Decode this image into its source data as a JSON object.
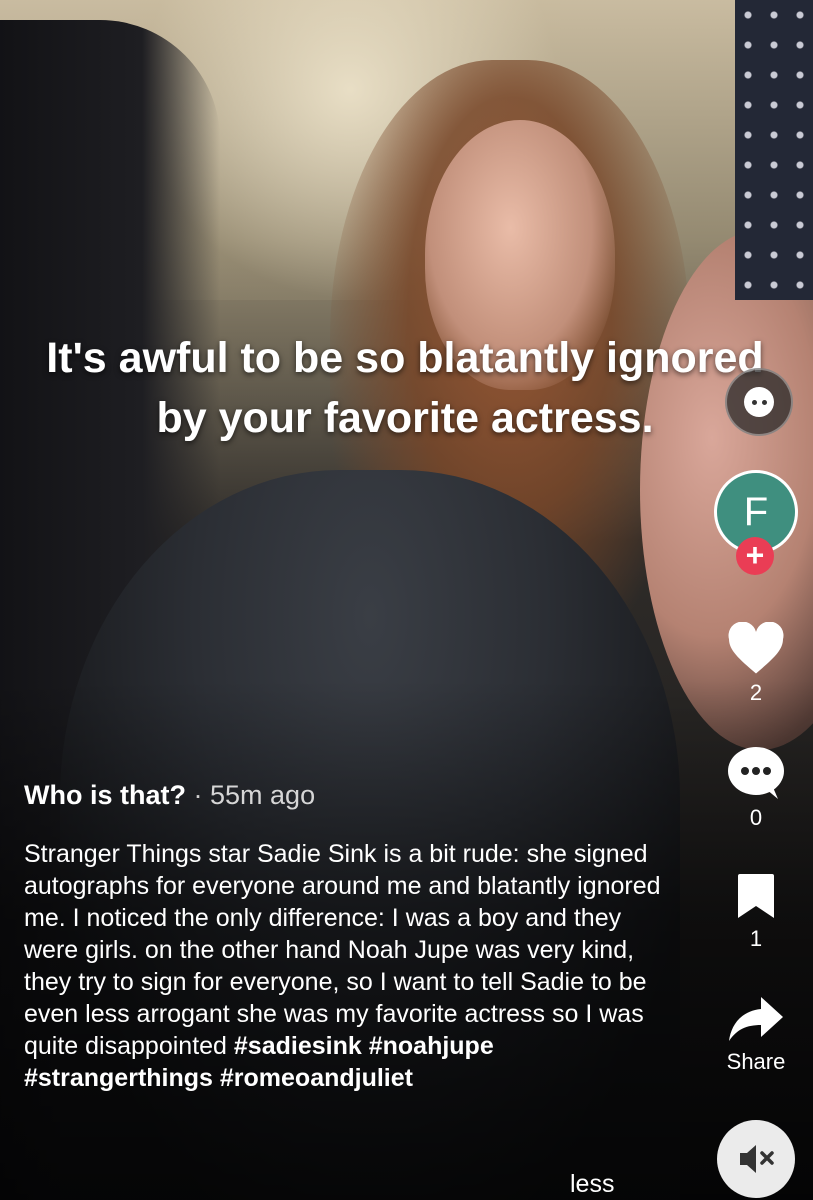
{
  "overlay_caption": "It's awful to be so blatantly ignored by your favorite actress.",
  "author": {
    "name": "Who is that?",
    "avatar_letter": "F",
    "follow_symbol": "+"
  },
  "separator": "·",
  "timestamp": "55m ago",
  "description": {
    "text": "Stranger Things star Sadie Sink is a bit rude: she signed autographs for everyone around me and blatantly ignored me. I noticed the only difference: I was a boy and they were girls. on the other hand Noah Jupe was very kind, they try to sign for everyone, so I want to tell Sadie to be even less arrogant she was my favorite actress so I was quite disappointed",
    "hashtags": [
      "#sadiesink",
      "#noahjupe",
      "#strangerthings",
      "#romeoandjuliet"
    ]
  },
  "less_label": "less",
  "actions": {
    "likes": "2",
    "comments": "0",
    "saves": "1",
    "share_label": "Share"
  },
  "icons": {
    "chat": "chat-bubble-icon",
    "like": "heart-icon",
    "comment": "comment-dots-icon",
    "save": "bookmark-icon",
    "share": "share-arrow-icon",
    "mute": "speaker-muted-icon"
  },
  "colors": {
    "avatar_bg": "#3f8f7f",
    "follow_red": "#ea3d55"
  }
}
